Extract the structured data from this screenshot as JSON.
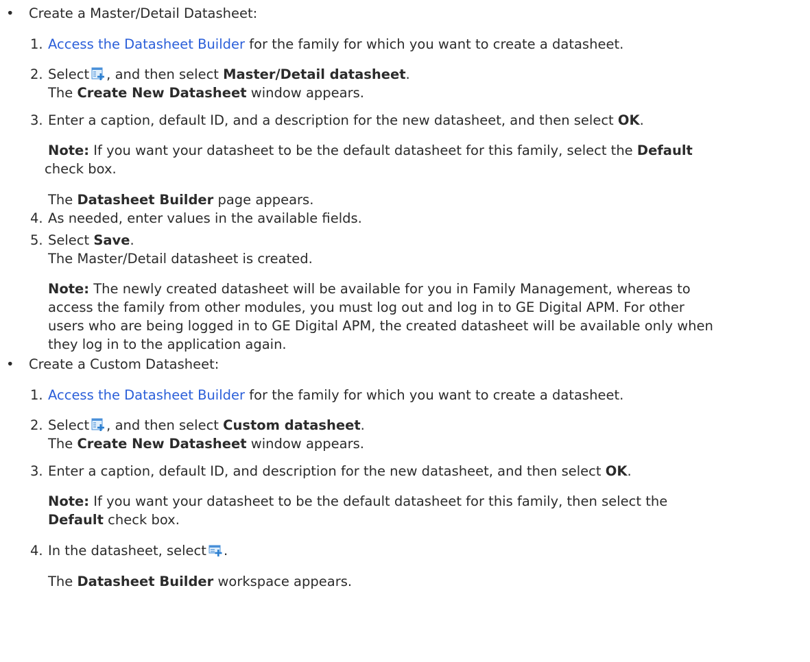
{
  "bullets": [
    {
      "title": "Create a Master/Detail Datasheet:",
      "steps": [
        {
          "num": "1.",
          "link": "Access the Datasheet Builder",
          "rest": " for the family for which you want to create a datasheet."
        },
        {
          "num": "2.",
          "pre": "Select",
          "icon": "add-datasheet-icon",
          "mid": ", and then select ",
          "bold": "Master/Detail datasheet",
          "post": ".",
          "result_bold": "Create New Datasheet",
          "result_rest": " window appears.",
          "result_pre": "The "
        },
        {
          "num": "3.",
          "text": "Enter a caption, default ID, and a description for the new datasheet, and then select ",
          "bold": "OK",
          "post": "."
        },
        {
          "note_label": "Note:",
          "note_text": " If you want your datasheet to be the default datasheet for this family, select the ",
          "note_bold": "Default",
          "note_post": " check box."
        },
        {
          "result_pre": "The ",
          "result_bold": "Datasheet Builder",
          "result_rest": " page appears."
        },
        {
          "num": "4.",
          "text": "As needed, enter values in the available fields."
        },
        {
          "num": "5.",
          "pre": "Select ",
          "bold": "Save",
          "post": ".",
          "result": "The Master/Detail datasheet is created."
        },
        {
          "note_label": "Note:",
          "note_line1": " The newly created datasheet will be available for you in Family Management, whereas to",
          "note_line2": "access the family from other modules, you must log out and log in to GE Digital APM. For other",
          "note_line3": "users who are being logged in to GE Digital APM, the created datasheet will be available only when",
          "note_line4": "they log in to the application again."
        }
      ]
    },
    {
      "title": "Create a Custom Datasheet:",
      "steps": [
        {
          "num": "1.",
          "link": "Access the Datasheet Builder",
          "rest": " for the family for which you want to create a datasheet."
        },
        {
          "num": "2.",
          "pre": "Select",
          "mid": ", and then select ",
          "bold": "Custom datasheet",
          "post": ".",
          "result_pre": "The ",
          "result_bold": "Create New Datasheet",
          "result_rest": " window appears."
        },
        {
          "num": "3.",
          "text": "Enter a caption, default ID, and description for the new datasheet, and then select ",
          "bold": "OK",
          "post": "."
        },
        {
          "note_label": "Note:",
          "note_line1": " If you want your datasheet to be the default datasheet for this family, then select the",
          "note_bold": "Default",
          "note_post": " check box."
        },
        {
          "num": "4.",
          "pre": "In the datasheet, select",
          "post": "."
        },
        {
          "result_pre": "The ",
          "result_bold": "Datasheet Builder",
          "result_rest": " workspace appears."
        }
      ]
    }
  ],
  "bullet_symbol": "•",
  "colors": {
    "link": "#2b5fd9",
    "text": "#2b2b2b",
    "icon_blue": "#3b8ed8"
  }
}
